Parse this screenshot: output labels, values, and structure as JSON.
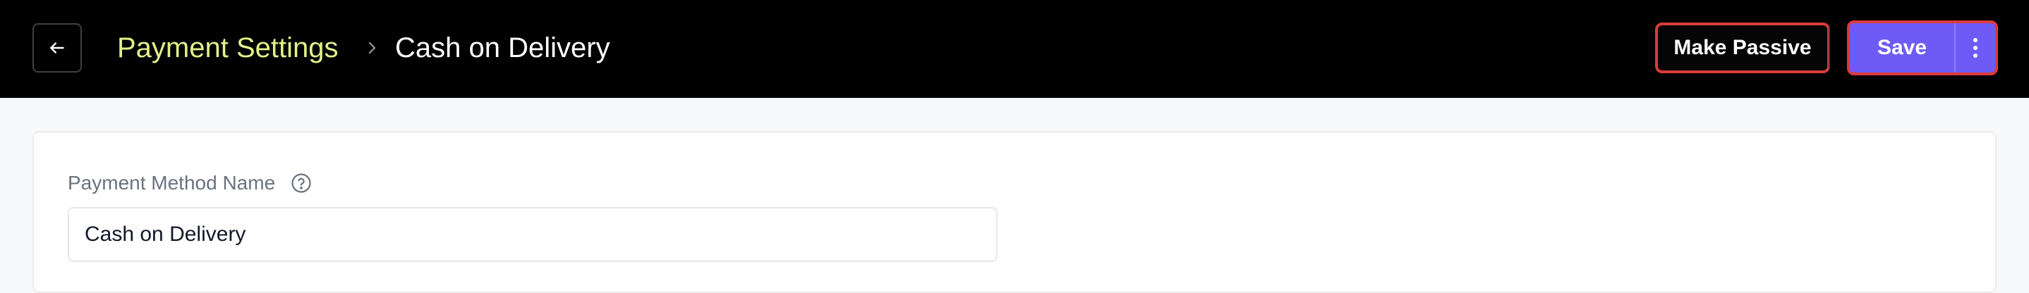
{
  "header": {
    "back_icon": "arrow-left-icon",
    "breadcrumb": {
      "parent": "Payment Settings",
      "separator_icon": "chevron-right-icon",
      "current": "Cash on Delivery"
    },
    "actions": {
      "make_passive_label": "Make Passive",
      "save_label": "Save",
      "more_icon": "more-vertical-icon"
    }
  },
  "form": {
    "payment_method_name": {
      "label": "Payment Method Name",
      "help_icon": "help-circle-icon",
      "value": "Cash on Delivery"
    }
  },
  "colors": {
    "header_bg": "#000000",
    "breadcrumb_parent": "#e2f08a",
    "primary": "#6e5bf6",
    "highlight_border": "#dc3a3a",
    "page_bg": "#f8f9fa"
  }
}
